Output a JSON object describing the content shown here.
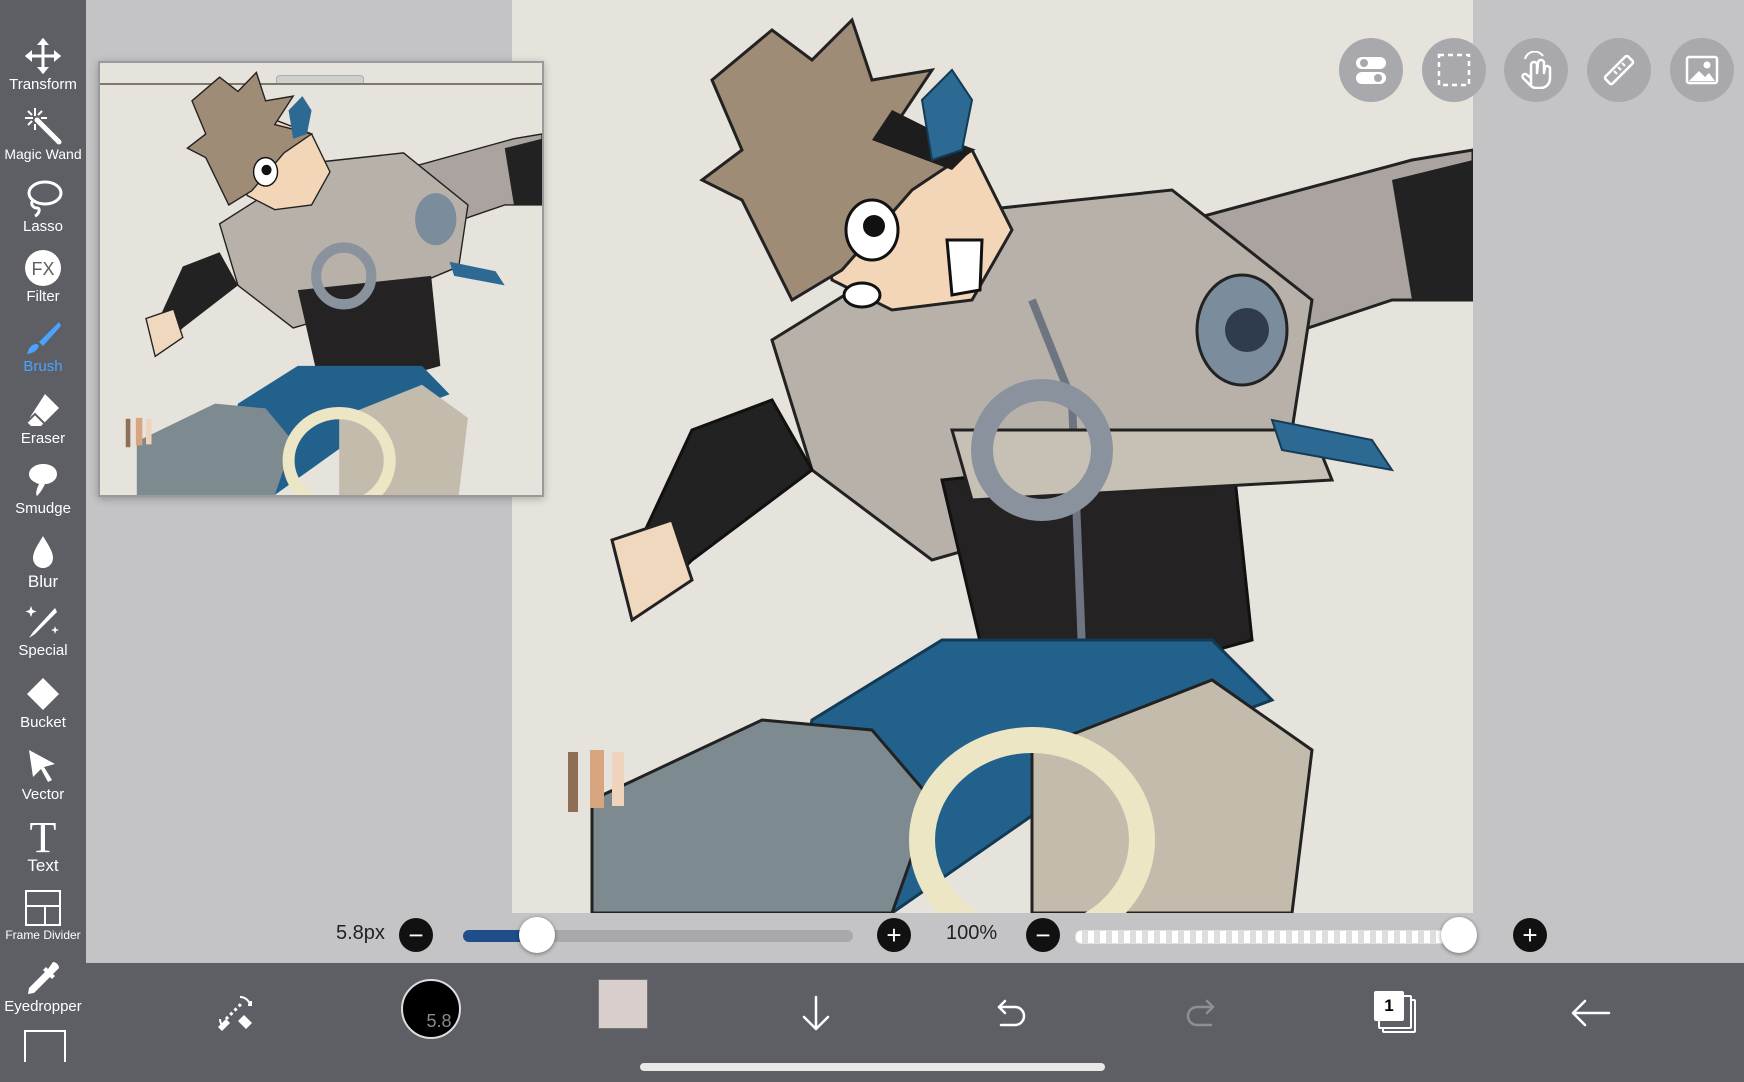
{
  "toolbar": {
    "tools": [
      {
        "label": "Transform",
        "icon": "move-arrows-icon"
      },
      {
        "label": "Magic Wand",
        "icon": "magic-wand-icon"
      },
      {
        "label": "Lasso",
        "icon": "lasso-icon"
      },
      {
        "label": "Filter",
        "icon": "fx-icon"
      },
      {
        "label": "Brush",
        "icon": "brush-icon",
        "active": true
      },
      {
        "label": "Eraser",
        "icon": "eraser-icon"
      },
      {
        "label": "Smudge",
        "icon": "smudge-icon"
      },
      {
        "label": "Blur",
        "icon": "drop-icon"
      },
      {
        "label": "Special",
        "icon": "sparkle-pen-icon"
      },
      {
        "label": "Bucket",
        "icon": "bucket-icon"
      },
      {
        "label": "Vector",
        "icon": "cursor-arrow-icon"
      },
      {
        "label": "Text",
        "icon": "text-t-icon"
      },
      {
        "label": "Frame Divider",
        "icon": "frame-divider-icon"
      },
      {
        "label": "Eyedropper",
        "icon": "eyedropper-icon"
      }
    ]
  },
  "top_buttons": [
    "toggle-icon",
    "selection-rect-icon",
    "hand-gesture-icon",
    "ruler-icon",
    "image-icon"
  ],
  "brush_size": {
    "label": "5.8px",
    "value": 5.8,
    "min": 0,
    "max": 100,
    "fraction": 0.19
  },
  "opacity": {
    "label": "100%",
    "fraction": 1.0
  },
  "bottom_bar": {
    "brush_indicator": "5.8",
    "color_swatch": "#d8cfcc",
    "layer_count": "1"
  },
  "colors": {
    "toolbar_bg": "#5d5f64",
    "accent": "#4aa3ff",
    "canvas_bg": "#e6e3dc"
  }
}
